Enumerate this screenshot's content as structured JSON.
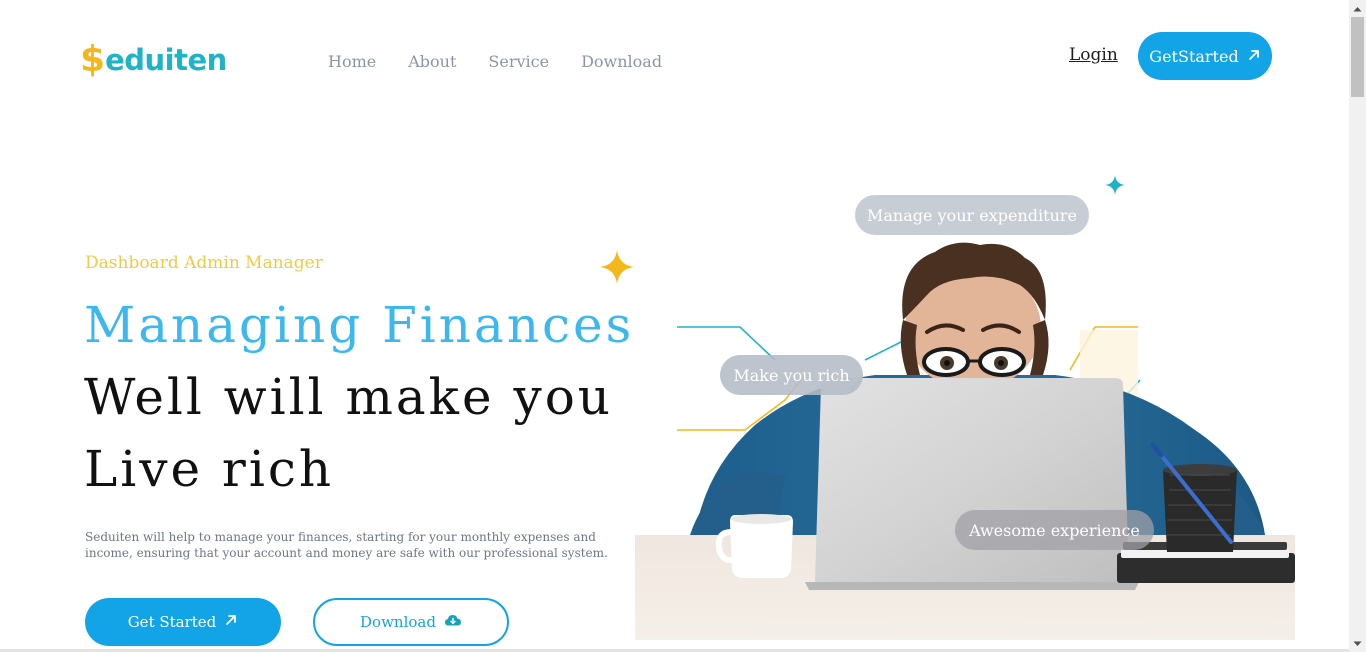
{
  "logo": {
    "symbol": "$",
    "text": "eduiten",
    "colors": {
      "symbol": "#f5b81c",
      "text": "#1fb3c7"
    }
  },
  "nav": {
    "items": [
      {
        "label": "Home"
      },
      {
        "label": "About"
      },
      {
        "label": "Service"
      },
      {
        "label": "Download"
      }
    ]
  },
  "header": {
    "login_label": "Login",
    "cta_label": "GetStarted",
    "cta_icon": "arrow-up-right-icon"
  },
  "hero": {
    "eyebrow": "Dashboard Admin Manager",
    "headline": {
      "line1": "Managing Finances",
      "line2": "Well will make you",
      "line3": "Live rich"
    },
    "description": "Seduiten will help to manage your finances, starting for your monthly expenses and income, ensuring that your account and money are safe with our professional system.",
    "primary_button": {
      "label": "Get Started",
      "icon": "arrow-up-right-icon"
    },
    "secondary_button": {
      "label": "Download",
      "icon": "cloud-download-icon"
    },
    "bubbles": [
      "Manage your expenditure",
      "Make you rich",
      "Awesome experience"
    ]
  },
  "colors": {
    "accent": "#12a4e6",
    "headline_blue": "#3cb8ef",
    "eyebrow": "#f4c842",
    "nav": "#8a96a6",
    "sparkle_teal": "#1fb3c7",
    "sparkle_yellow": "#f5b81c"
  }
}
